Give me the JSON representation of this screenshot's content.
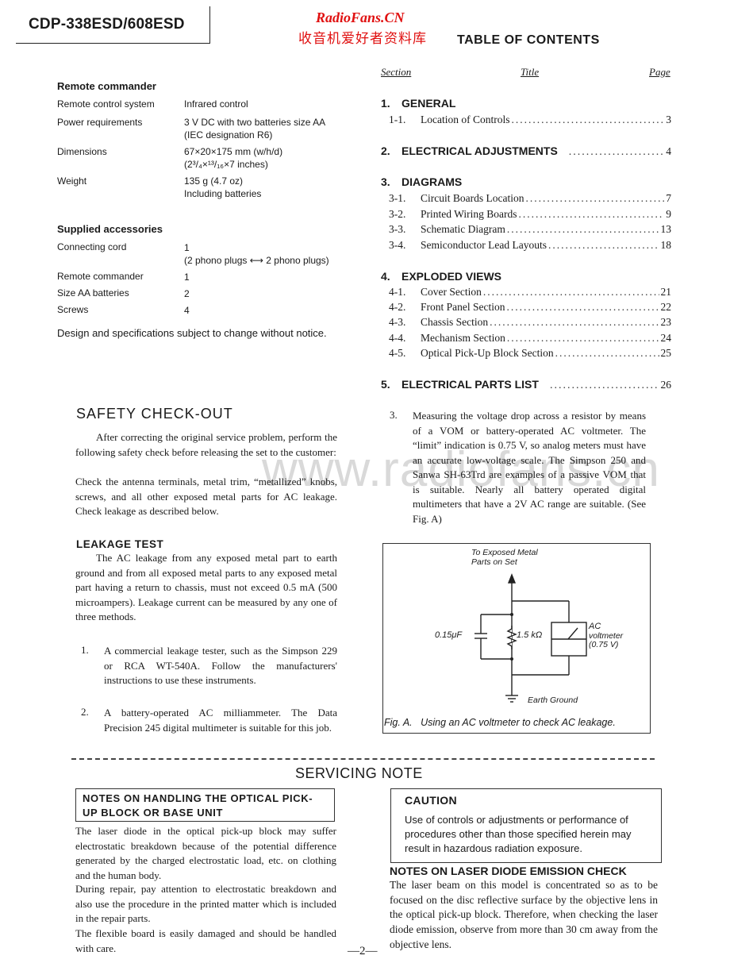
{
  "header": {
    "model": "CDP-338ESD/608ESD",
    "watermark_en": "RadioFans.CN",
    "watermark_cn": "收音机爱好者资料库",
    "toc_title": "TABLE OF CONTENTS"
  },
  "specs": {
    "remote_heading": "Remote commander",
    "remote_rows": [
      {
        "label": "Remote control system",
        "value": "Infrared control",
        "value2": ""
      },
      {
        "label": "Power requirements",
        "value": "3 V DC with two batteries size AA",
        "value2": "(IEC designation R6)"
      },
      {
        "label": "Dimensions",
        "value": "67×20×175 mm (w/h/d)",
        "value2": "(2³/₄×¹³/₁₆×7 inches)"
      },
      {
        "label": "Weight",
        "value": "135 g (4.7 oz)",
        "value2": "Including batteries"
      }
    ],
    "accessories_heading": "Supplied accessories",
    "accessory_rows": [
      {
        "label": "Connecting cord",
        "value": "1",
        "value2": "(2 phono plugs ⟷ 2 phono plugs)"
      },
      {
        "label": "Remote commander",
        "value": "1",
        "value2": ""
      },
      {
        "label": "Size AA batteries",
        "value": "2",
        "value2": ""
      },
      {
        "label": "Screws",
        "value": "4",
        "value2": ""
      }
    ],
    "note": "Design and specifications subject to change without notice."
  },
  "toc": {
    "col_section": "Section",
    "col_title": "Title",
    "col_page": "Page",
    "sections": [
      {
        "num": "1.",
        "title": "GENERAL",
        "page": "",
        "items": [
          {
            "num": "1-1.",
            "title": "Location of Controls",
            "page": "3"
          }
        ]
      },
      {
        "num": "2.",
        "title": "ELECTRICAL ADJUSTMENTS",
        "page": "4",
        "items": []
      },
      {
        "num": "3.",
        "title": "DIAGRAMS",
        "page": "",
        "items": [
          {
            "num": "3-1.",
            "title": "Circuit Boards Location",
            "page": "7"
          },
          {
            "num": "3-2.",
            "title": "Printed Wiring Boards",
            "page": "9"
          },
          {
            "num": "3-3.",
            "title": "Schematic Diagram",
            "page": "13"
          },
          {
            "num": "3-4.",
            "title": "Semiconductor Lead Layouts",
            "page": "18"
          }
        ]
      },
      {
        "num": "4.",
        "title": "EXPLODED VIEWS",
        "page": "",
        "items": [
          {
            "num": "4-1.",
            "title": "Cover Section",
            "page": "21"
          },
          {
            "num": "4-2.",
            "title": "Front Panel Section",
            "page": "22"
          },
          {
            "num": "4-3.",
            "title": "Chassis Section",
            "page": "23"
          },
          {
            "num": "4-4.",
            "title": "Mechanism Section",
            "page": "24"
          },
          {
            "num": "4-5.",
            "title": "Optical Pick-Up Block Section",
            "page": "25"
          }
        ]
      },
      {
        "num": "5.",
        "title": "ELECTRICAL PARTS LIST",
        "page": "26",
        "items": []
      }
    ]
  },
  "safety": {
    "title": "SAFETY CHECK-OUT",
    "intro": "After correcting the original service problem, perform the following safety check before releasing the set to the customer:",
    "intro2": "Check the antenna terminals, metal trim, “metallized” knobs, screws, and all other exposed metal parts for AC leakage. Check leakage as described below.",
    "leakage_title": "LEAKAGE TEST",
    "leakage_text": "The AC leakage from any exposed metal part to earth ground and from all exposed metal parts to any exposed metal part having a return to chassis, must not exceed 0.5 mA (500 microampers). Leakage current can be measured by any one of three methods.",
    "methods": [
      {
        "num": "1.",
        "text": "A commercial leakage tester, such as the Simpson 229 or RCA WT-540A. Follow the manufacturers' instructions to use these instruments."
      },
      {
        "num": "2.",
        "text": "A battery-operated AC milliammeter. The Data Precision 245 digital multimeter is suitable for this job."
      },
      {
        "num": "3.",
        "text": "Measuring the voltage drop across a resistor by means of a VOM or battery-operated AC voltmeter. The “limit” indication is 0.75 V, so analog meters must have an accurate low-voltage scale. The Simpson 250 and Sanwa SH-63Trd are examples of a passive VOM that is suitable. Nearly all battery operated digital multimeters that have a 2V AC range are suitable. (See Fig. A)"
      }
    ],
    "watermark_url": "www.radiofans.cn"
  },
  "figure": {
    "top_label_1": "To Exposed Metal",
    "top_label_2": "Parts on Set",
    "capacitor": "0.15μF",
    "resistor": "1.5 kΩ",
    "meter_1": "AC",
    "meter_2": "voltmeter",
    "meter_3": "(0.75 V)",
    "ground": "Earth Ground",
    "caption": "Fig. A.   Using an AC voltmeter to check AC leakage."
  },
  "servicing": {
    "title": "SERVICING NOTE",
    "notes_title_1": "NOTES ON HANDLING THE OPTICAL PICK-",
    "notes_title_2": "UP BLOCK OR BASE UNIT",
    "notes_p1": "The laser diode in the optical pick-up block may suffer electrostatic breakdown because of the potential difference generated by the charged electrostatic load, etc. on clothing and the human body.",
    "notes_p2": "During repair, pay attention to electrostatic breakdown and also use the procedure in the printed matter which is included in the repair parts.",
    "notes_p3": "The flexible board is easily damaged and should be handled with care.",
    "caution_title": "CAUTION",
    "caution_text": "Use of controls or adjustments or performance of procedures other than those specified herein may result in hazardous radiation exposure.",
    "laser_title": "NOTES ON LASER DIODE EMISSION CHECK",
    "laser_text": "The laser beam on this model is concentrated so as to be focused on the disc reflective surface by the objective lens in the optical pick-up block. Therefore, when checking the laser diode emission, observe from more than 30 cm away from the objective lens."
  },
  "footer": {
    "page": "—2—"
  }
}
